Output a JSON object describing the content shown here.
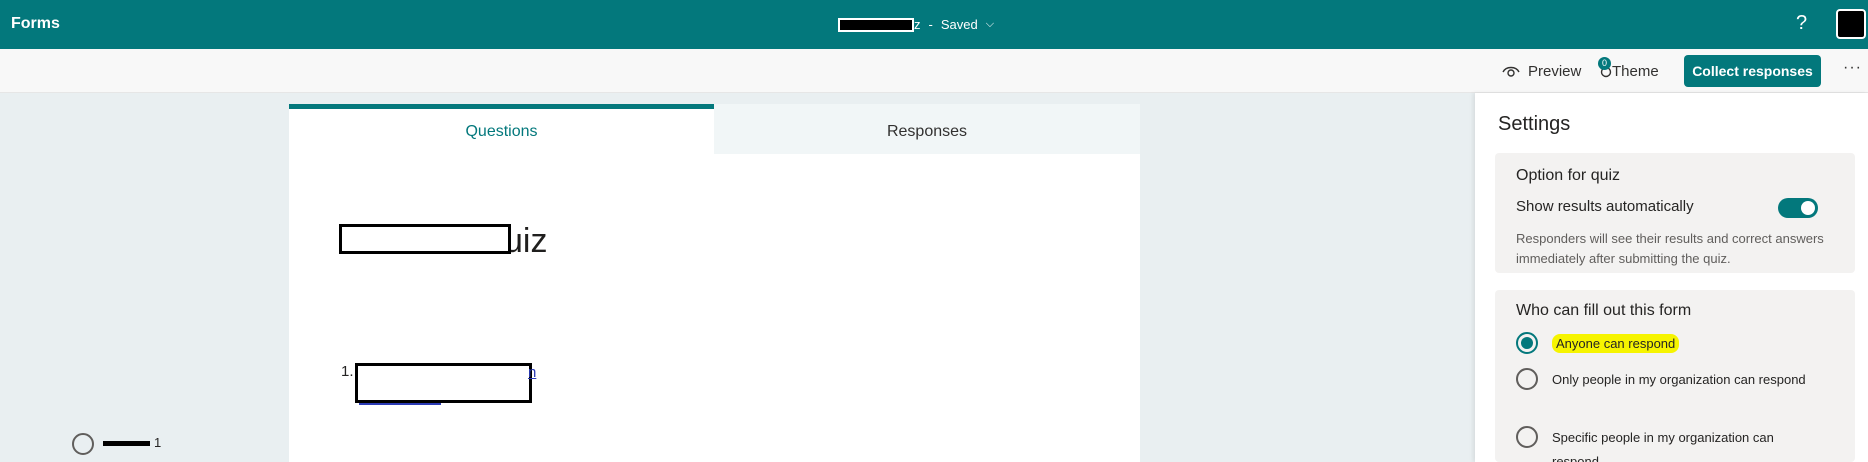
{
  "header": {
    "app_name": "Forms",
    "doc_title_tail": "z",
    "separator": "-",
    "save_status": "Saved",
    "chevron": "⌵",
    "help": "?"
  },
  "toolbar": {
    "preview_label": "Preview",
    "theme_label": "Theme",
    "theme_badge": "0",
    "collect_label": "Collect responses",
    "more": "···"
  },
  "tabs": [
    {
      "label": "Questions",
      "active": true
    },
    {
      "label": "Responses",
      "active": false
    }
  ],
  "form": {
    "title_tail": "uiz",
    "question": {
      "number": "1.",
      "tail": "n"
    },
    "option_label": "1"
  },
  "settings": {
    "title": "Settings",
    "quiz_section": {
      "heading": "Option for quiz",
      "toggle_label": "Show results automatically",
      "toggle_on": true,
      "description": "Responders will see their results and correct answers immediately after submitting the quiz."
    },
    "who_section": {
      "heading": "Who can fill out this form",
      "options": [
        {
          "label": "Anyone can respond",
          "selected": true
        },
        {
          "label": "Only people in my organization can respond",
          "selected": false
        },
        {
          "label": "Specific people in my organization can respond",
          "selected": false
        }
      ]
    }
  },
  "colors": {
    "brand": "#03787c",
    "highlight": "#f6f400"
  },
  "icons": [
    "eye-icon",
    "palette-icon",
    "chevron-down-icon",
    "help-icon",
    "more-icon"
  ]
}
